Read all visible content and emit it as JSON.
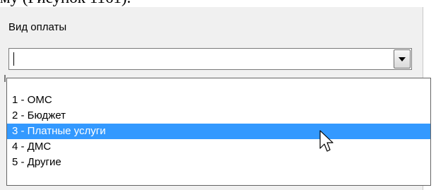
{
  "document_text": "му (Рисунок 1161).",
  "field": {
    "label": "Вид оплаты",
    "value": "",
    "dropdown_icon": "chevron-down-icon"
  },
  "dropdown": {
    "selected_index": 2,
    "items": [
      {
        "label": "1 - ОМС"
      },
      {
        "label": "2 - Бюджет"
      },
      {
        "label": "3 - Платные услуги"
      },
      {
        "label": "4 - ДМС"
      },
      {
        "label": "5 - Другие"
      }
    ]
  },
  "colors": {
    "highlight": "#3399ff",
    "panel_bg": "#f0f0f0",
    "border": "#7a7a7a"
  },
  "pointer_icon": "mouse-pointer-icon"
}
